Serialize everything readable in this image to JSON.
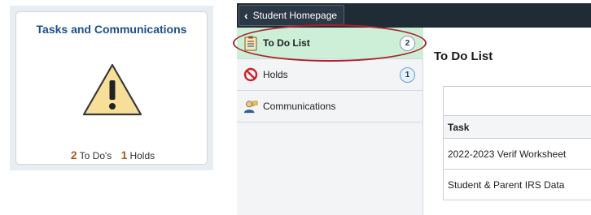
{
  "tile": {
    "title": "Tasks and Communications",
    "todo_count": "2",
    "todo_label": "To Do's",
    "holds_count": "1",
    "holds_label": "Holds",
    "icon": "warning-icon"
  },
  "topbar": {
    "back_label": "Student Homepage",
    "back_icon": "chevron-left-icon"
  },
  "sidebar": {
    "items": [
      {
        "label": "To Do List",
        "badge": "2",
        "icon": "clipboard-icon",
        "active": true
      },
      {
        "label": "Holds",
        "badge": "1",
        "icon": "no-entry-icon",
        "active": false
      },
      {
        "label": "Communications",
        "badge": "",
        "icon": "person-chat-icon",
        "active": false
      }
    ]
  },
  "main": {
    "title": "To Do List",
    "table": {
      "header": "Task",
      "rows": [
        "2022-2023 Verif Worksheet",
        "Student & Parent IRS Data"
      ]
    }
  },
  "colors": {
    "tile_title": "#1b4f8c",
    "count_accent": "#b05a1f",
    "topbar_bg": "#1f2b35",
    "active_nav_bg": "#cdeed7",
    "highlight_ring": "#a8232a",
    "warning_fill": "#f7df9a"
  }
}
